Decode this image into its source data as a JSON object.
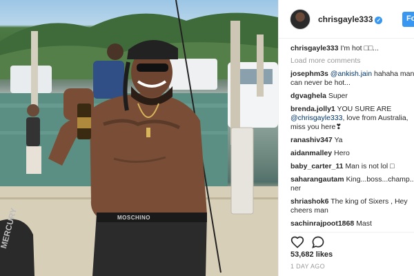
{
  "header": {
    "username": "chrisgayle333",
    "follow_label": "Fo"
  },
  "caption": {
    "user": "chrisgayle333",
    "text": "I'm hot □□..."
  },
  "load_more_label": "Load more comments",
  "comments": [
    {
      "user": "josephm3s",
      "mention": "@ankish.jain",
      "text": " hahaha man",
      "cont": "can never be hot..."
    },
    {
      "user": "dgvaghela",
      "text": "Super"
    },
    {
      "user": "brenda.jolly1",
      "text": "YOU SURE ARE",
      "mention2": "@chrisgayle333",
      "text2": ", love from Australia,",
      "text3": "miss you here❣"
    },
    {
      "user": "ranashiv347",
      "text": "Ya"
    },
    {
      "user": "aidanmalley",
      "text": "Hero"
    },
    {
      "user": "baby_carter_11",
      "text": "Man is not lol □"
    },
    {
      "user": "saharangautam",
      "text": "King...boss...champ...",
      "cont": "ner"
    },
    {
      "user": "shriashok6",
      "text": "The king of Sixers , Hey",
      "cont": "cheers man"
    },
    {
      "user": "sachinrajpoot1868",
      "text": "Mast"
    }
  ],
  "actions": {
    "like_icon": "heart-icon",
    "comment_icon": "comment-icon"
  },
  "likes": "53,682 likes",
  "time_ago": "1 DAY AGO",
  "photo": {
    "cap_text": "MOSCHINO",
    "engine_text": "MERCURY"
  },
  "colors": {
    "accent": "#3897f0",
    "mention": "#003569",
    "muted": "#999999"
  }
}
